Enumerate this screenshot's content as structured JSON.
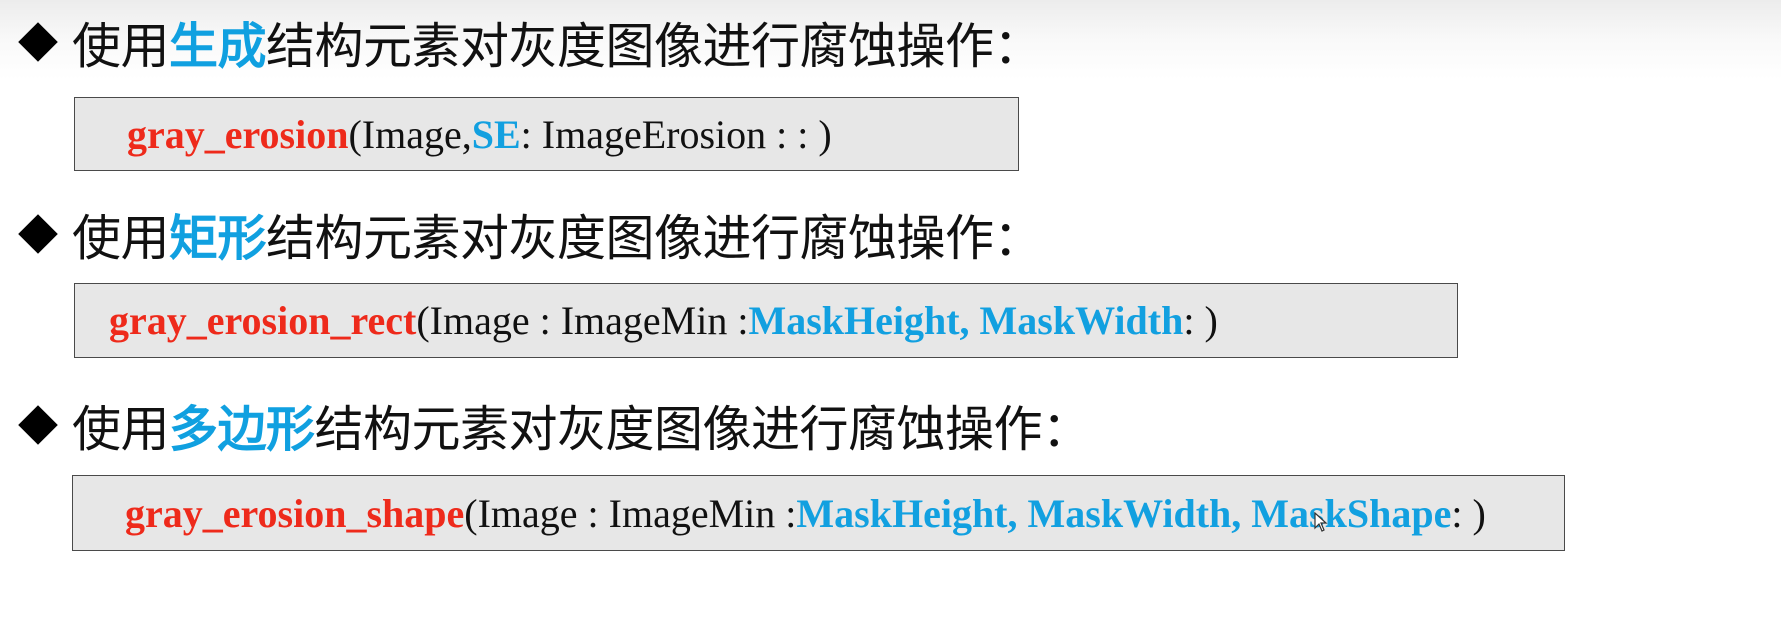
{
  "sections": [
    {
      "heading_prefix": "使用",
      "heading_keyword": "生成",
      "heading_suffix": "结构元素对灰度图像进行腐蚀操作：",
      "code": {
        "function": "gray_erosion",
        "open": "(Image, ",
        "params": "SE",
        "rest": " : ImageErosion : : )"
      }
    },
    {
      "heading_prefix": "使用",
      "heading_keyword": "矩形",
      "heading_suffix": "结构元素对灰度图像进行腐蚀操作：",
      "code": {
        "function": "gray_erosion_rect",
        "open": "(Image : ImageMin : ",
        "params": "MaskHeight, MaskWidth",
        "rest": " : )"
      }
    },
    {
      "heading_prefix": "使用",
      "heading_keyword": "多边形",
      "heading_suffix": "结构元素对灰度图像进行腐蚀操作：",
      "code": {
        "function": "gray_erosion_shape",
        "open": "(Image : ImageMin : ",
        "params": "MaskHeight, MaskWidth, MaskShape",
        "rest": " : )"
      }
    }
  ],
  "colors": {
    "keyword": "#10a0e0",
    "function": "#ee2a1b",
    "param": "#12a0e0",
    "code_box_bg": "#e7e7e7"
  },
  "icons": {
    "bullet": "diamond-bullet-icon",
    "cursor": "mouse-pointer-icon"
  }
}
